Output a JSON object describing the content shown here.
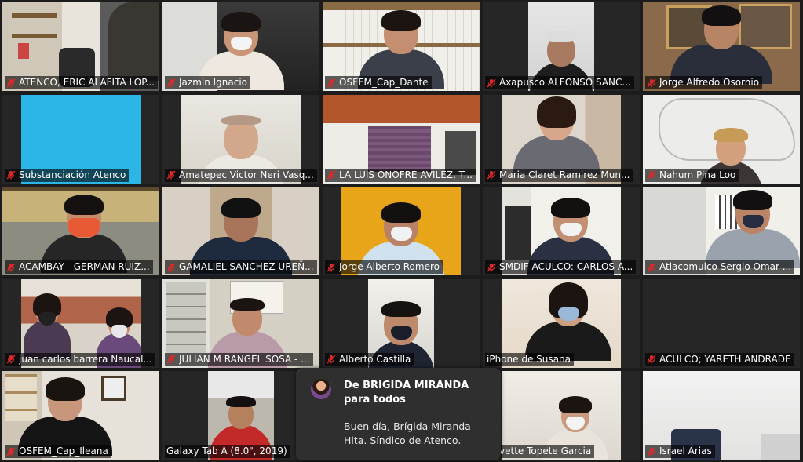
{
  "participants": [
    {
      "name": "ATENCO, ERIC ALAFITA LOP...",
      "muted": true
    },
    {
      "name": "Jazmín Ignacio",
      "muted": true
    },
    {
      "name": "OSFEM_Cap_Dante",
      "muted": true
    },
    {
      "name": "Axapusco ALFONSO SANC...",
      "muted": true
    },
    {
      "name": "Jorge Alfredo Osornio",
      "muted": true
    },
    {
      "name": "Substanciación Atenco",
      "muted": true
    },
    {
      "name": "Amatepec Victor Neri Vasq...",
      "muted": true
    },
    {
      "name": "LA LUIS ONOFRE AVILEZ, T...",
      "muted": true
    },
    {
      "name": "Maria Claret Ramirez  Mun...",
      "muted": true
    },
    {
      "name": "Nahum Pina Loo",
      "muted": true
    },
    {
      "name": "ACAMBAY - GERMAN RUIZ...",
      "muted": true
    },
    {
      "name": "GAMALIEL SANCHEZ UREÑ...",
      "muted": true
    },
    {
      "name": "Jorge Alberto Romero",
      "muted": true
    },
    {
      "name": "SMDIF ACULCO: CARLOS A...",
      "muted": true
    },
    {
      "name": "Atlacomulco Sergio Omar ...",
      "muted": true
    },
    {
      "name": "juan carlos barrera Naucal...",
      "muted": true
    },
    {
      "name": "JULIAN M RANGEL SOSA - ...",
      "muted": true
    },
    {
      "name": "Alberto Castilla",
      "muted": true
    },
    {
      "name": "iPhone de Susana",
      "muted": false
    },
    {
      "name": "ACULCO; YARETH ANDRADE",
      "muted": true
    },
    {
      "name": "OSFEM_Cap_Ileana",
      "muted": true
    },
    {
      "name": "Galaxy Tab A (8.0\", 2019)",
      "muted": false
    },
    {
      "name": "",
      "muted": false
    },
    {
      "name": "vette Topete Garcia",
      "muted": true
    },
    {
      "name": "Israel Arias",
      "muted": true
    }
  ],
  "chat_notification": {
    "from": "De BRIGIDA MIRANDA para todos",
    "message": "Buen día, Brígida Miranda Hita. Síndico de Atenco."
  },
  "colors": {
    "background": "#1c1c1c",
    "tile": "#262626",
    "muted_icon": "#e02828",
    "chat_bg": "#2f2f2f"
  },
  "icons": {
    "muted": "microphone-muted-icon"
  }
}
